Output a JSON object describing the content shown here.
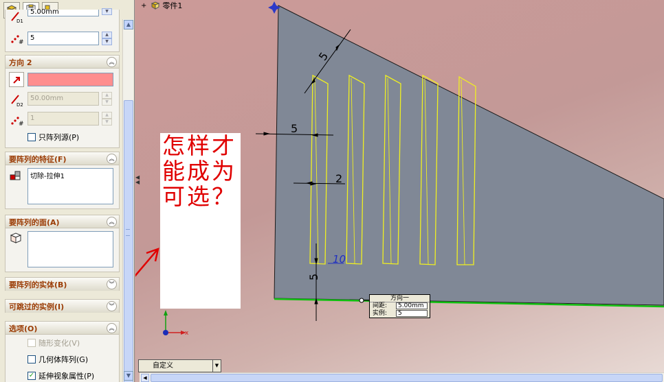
{
  "property_manager": {
    "tabs": [
      {
        "name": "feature-manager-tab-icon"
      },
      {
        "name": "property-manager-tab-icon"
      },
      {
        "name": "configuration-manager-tab-icon"
      }
    ],
    "direction1": {
      "spacing_label": "D1",
      "spacing_value": "5.00mm",
      "instances_value": "5"
    },
    "direction2": {
      "title": "方向 2",
      "spacing_label": "D2",
      "spacing_value": "50.00mm",
      "instances_value": "1",
      "pattern_seed_only": "只阵列源(P)",
      "pattern_seed_only_checked": false
    },
    "features_to_pattern": {
      "title": "要阵列的特征(F)",
      "items": [
        "切除-拉伸1"
      ]
    },
    "faces_to_pattern": {
      "title": "要阵列的面(A)",
      "items": []
    },
    "bodies_to_pattern": {
      "title": "要阵列的实体(B)"
    },
    "instances_to_skip": {
      "title": "可跳过的实例(I)"
    },
    "options": {
      "title": "选项(O)",
      "vary_sketch": "随形变化(V)",
      "vary_sketch_checked": false,
      "vary_sketch_enabled": false,
      "geometry_pattern": "几何体阵列(G)",
      "geometry_pattern_checked": false,
      "propagate_visual": "延伸视象属性(P)",
      "propagate_visual_checked": true
    }
  },
  "graphics": {
    "tree_root_label": "零件1",
    "note_text": "怎样才能成为可选？",
    "dimensions": {
      "hyp_offset": "5",
      "left_offset": "5",
      "slot_width": "2",
      "bottom_offset": "5",
      "slot_height_partial": "10"
    },
    "direction_callout": {
      "title": "方向一",
      "spacing_label": "间距:",
      "spacing_value": "5.00mm",
      "instances_label": "实例:",
      "instances_value": "5"
    },
    "triad": {
      "x_label": "x"
    },
    "config_dropdown": "自定义"
  },
  "colors": {
    "face": "#808896",
    "slot_outline": "#f0f020",
    "note_text": "#e00000",
    "arrow": "#e00000",
    "edge_highlight": "#10c010",
    "group_title": "#9b3c05"
  }
}
